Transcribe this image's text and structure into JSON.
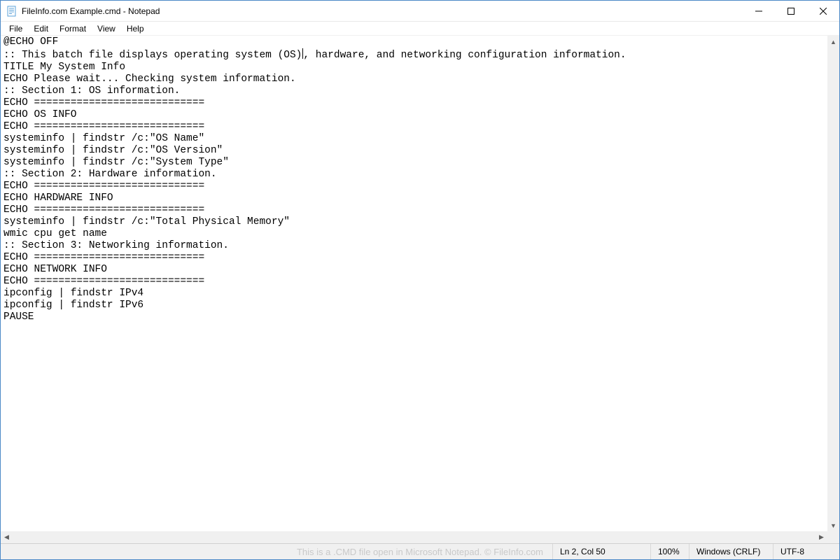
{
  "window": {
    "title": "FileInfo.com Example.cmd - Notepad"
  },
  "menu": {
    "file": "File",
    "edit": "Edit",
    "format": "Format",
    "view": "View",
    "help": "Help"
  },
  "editor": {
    "line01": "@ECHO OFF",
    "line02a": ":: This batch file displays operating system (OS)",
    "line02b": ", hardware, and networking configuration information.",
    "line03": "TITLE My System Info",
    "line04": "ECHO Please wait... Checking system information.",
    "line05": ":: Section 1: OS information.",
    "line06": "ECHO ============================",
    "line07": "ECHO OS INFO",
    "line08": "ECHO ============================",
    "line09": "systeminfo | findstr /c:\"OS Name\"",
    "line10": "systeminfo | findstr /c:\"OS Version\"",
    "line11": "systeminfo | findstr /c:\"System Type\"",
    "line12": ":: Section 2: Hardware information.",
    "line13": "ECHO ============================",
    "line14": "ECHO HARDWARE INFO",
    "line15": "ECHO ============================",
    "line16": "systeminfo | findstr /c:\"Total Physical Memory\"",
    "line17": "wmic cpu get name",
    "line18": ":: Section 3: Networking information.",
    "line19": "ECHO ============================",
    "line20": "ECHO NETWORK INFO",
    "line21": "ECHO ============================",
    "line22": "ipconfig | findstr IPv4",
    "line23": "ipconfig | findstr IPv6",
    "line24": "PAUSE"
  },
  "status": {
    "watermark": "This is a .CMD file open in Microsoft Notepad. © FileInfo.com",
    "position": "Ln 2, Col 50",
    "zoom": "100%",
    "eol": "Windows (CRLF)",
    "encoding": "UTF-8"
  },
  "scroll": {
    "up": "▲",
    "down": "▼",
    "left": "◀",
    "right": "▶"
  }
}
